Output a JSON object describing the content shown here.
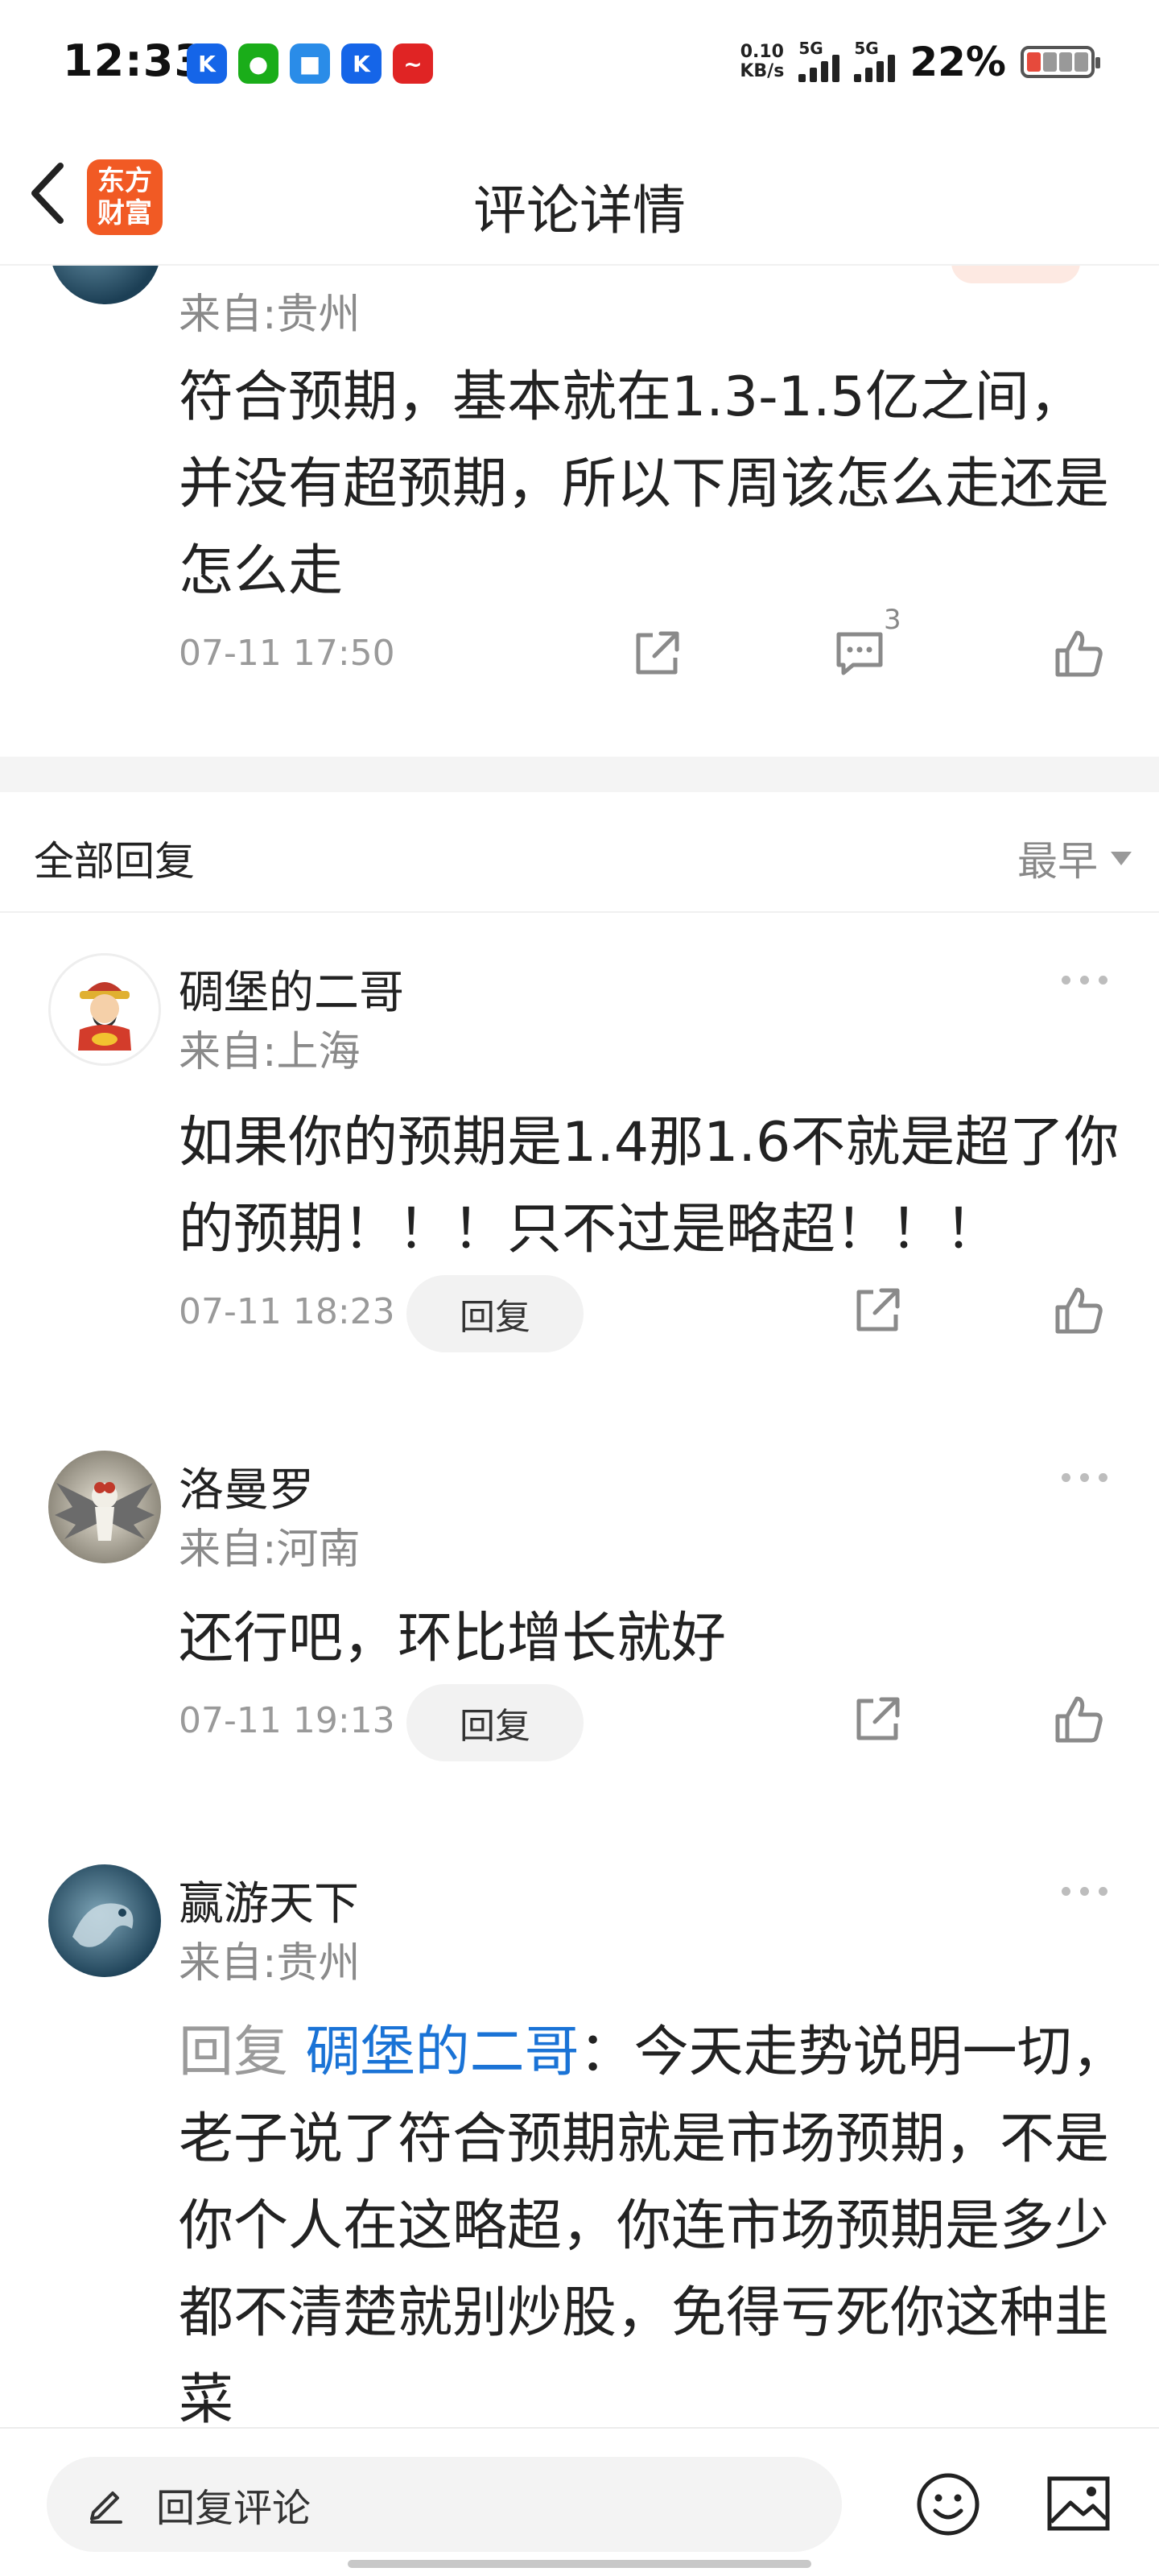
{
  "status_bar": {
    "time": "12:33",
    "net_speed_value": "0.10",
    "net_speed_unit": "KB/s",
    "signal1_label": "5G",
    "signal2_label": "5G",
    "battery_pct": "22%",
    "apps": [
      {
        "name": "k-app-icon",
        "glyph": "K",
        "color": "#1565e8"
      },
      {
        "name": "wechat-icon",
        "glyph": "●",
        "color": "#1aad19"
      },
      {
        "name": "cloud-app-icon",
        "glyph": "■",
        "color": "#2a8ce8"
      },
      {
        "name": "k-app-icon-2",
        "glyph": "K",
        "color": "#1565e8"
      },
      {
        "name": "stock-app-icon",
        "glyph": "~",
        "color": "#e02424"
      }
    ]
  },
  "header": {
    "title": "评论详情",
    "logo_line1": "东方",
    "logo_line2": "财富"
  },
  "main_comment": {
    "location": "来自:贵州",
    "text": "符合预期，基本就在1.3-1.5亿之间，并没有超预期，所以下周该怎么走还是怎么走",
    "time": "07-11 17:50",
    "comment_count": "3"
  },
  "replies_header": {
    "title": "全部回复",
    "sort_label": "最早"
  },
  "replies": [
    {
      "username": "碉堡的二哥",
      "location": "来自:上海",
      "text": "如果你的预期是1.4那1.6不就是超了你的预期！！！只不过是略超！！！",
      "time": "07-11 18:23",
      "reply_label": "回复"
    },
    {
      "username": "洛曼罗",
      "location": "来自:河南",
      "text": "还行吧，环比增长就好",
      "time": "07-11 19:13",
      "reply_label": "回复"
    },
    {
      "username": "赢游天下",
      "location": "来自:贵州",
      "reply_prefix": "回复",
      "mention": "碉堡的二哥",
      "text": "：今天走势说明一切，老子说了符合预期就是市场预期，不是你个人在这略超，你连市场预期是多少都不清楚就别炒股，免得亏死你这种韭菜"
    }
  ],
  "bottom_bar": {
    "input_placeholder": "回复评论"
  }
}
